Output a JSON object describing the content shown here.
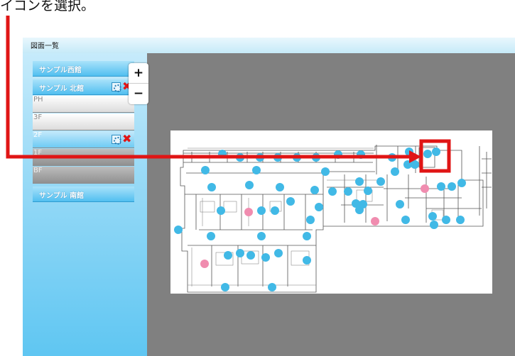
{
  "caption": "イコンを選択。",
  "header": {
    "title": "図面一覧"
  },
  "zoom": {
    "in_label": "+",
    "out_label": "−"
  },
  "buildings": [
    {
      "label": "サンプル西館"
    },
    {
      "label": "サンプル 北館",
      "floors": [
        "PH",
        "3F",
        "2F",
        "1F",
        "BF"
      ],
      "selected_floor": "2F"
    },
    {
      "label": "サンプル 南館"
    }
  ],
  "colors": {
    "marker_blue": "#41b9e6",
    "marker_pink": "#f08caf",
    "highlight_red": "#e01515"
  }
}
